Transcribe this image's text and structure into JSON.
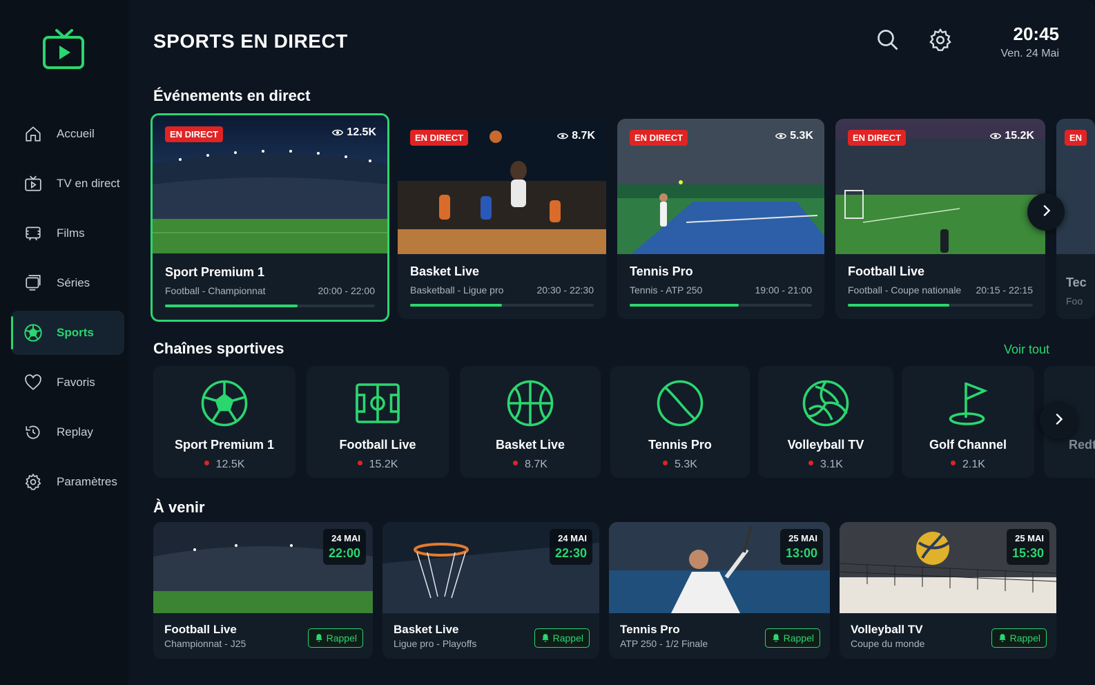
{
  "header": {
    "title": "SPORTS EN DIRECT",
    "time": "20:45",
    "date": "Ven. 24 Mai"
  },
  "sidebar": {
    "items": [
      {
        "label": "Accueil",
        "icon": "home-icon"
      },
      {
        "label": "TV en direct",
        "icon": "tv-icon"
      },
      {
        "label": "Films",
        "icon": "film-icon"
      },
      {
        "label": "Séries",
        "icon": "series-icon"
      },
      {
        "label": "Sports",
        "icon": "soccer-ball-icon",
        "active": true
      },
      {
        "label": "Favoris",
        "icon": "heart-icon"
      },
      {
        "label": "Replay",
        "icon": "history-icon"
      },
      {
        "label": "Paramètres",
        "icon": "gear-icon"
      }
    ]
  },
  "live": {
    "title": "Événements en direct",
    "badge": "EN DIRECT",
    "cards": [
      {
        "name": "Sport Premium 1",
        "subtitle": "Football - Championnat",
        "time": "20:00 - 22:00",
        "viewers": "12.5K",
        "progress": 0.63
      },
      {
        "name": "Basket Live",
        "subtitle": "Basketball - Ligue pro",
        "time": "20:30 - 22:30",
        "viewers": "8.7K",
        "progress": 0.5
      },
      {
        "name": "Tennis Pro",
        "subtitle": "Tennis - ATP 250",
        "time": "19:00 - 21:00",
        "viewers": "5.3K",
        "progress": 0.6
      },
      {
        "name": "Football Live",
        "subtitle": "Football - Coupe nationale",
        "time": "20:15 - 22:15",
        "viewers": "15.2K",
        "progress": 0.55
      },
      {
        "name": "Tec",
        "subtitle": "Foo"
      }
    ],
    "partial_badge": "EN"
  },
  "channels": {
    "title": "Chaînes sportives",
    "see_all": "Voir tout",
    "items": [
      {
        "name": "Sport Premium 1",
        "viewers": "12.5K",
        "icon": "soccer-ball-icon"
      },
      {
        "name": "Football Live",
        "viewers": "15.2K",
        "icon": "football-pitch-icon"
      },
      {
        "name": "Basket Live",
        "viewers": "8.7K",
        "icon": "basketball-icon"
      },
      {
        "name": "Tennis Pro",
        "viewers": "5.3K",
        "icon": "tennis-ball-icon"
      },
      {
        "name": "Volleyball TV",
        "viewers": "3.1K",
        "icon": "volleyball-icon"
      },
      {
        "name": "Golf Channel",
        "viewers": "2.1K",
        "icon": "golf-flag-icon"
      },
      {
        "name": "Redt",
        "viewers": ""
      }
    ]
  },
  "upcoming": {
    "title": "À venir",
    "reminder_label": "Rappel",
    "items": [
      {
        "name": "Football Live",
        "subtitle": "Championnat - J25",
        "date": "24 MAI",
        "time": "22:00"
      },
      {
        "name": "Basket Live",
        "subtitle": "Ligue pro - Playoffs",
        "date": "24 MAI",
        "time": "22:30"
      },
      {
        "name": "Tennis Pro",
        "subtitle": "ATP 250 - 1/2 Finale",
        "date": "25 MAI",
        "time": "13:00"
      },
      {
        "name": "Volleyball TV",
        "subtitle": "Coupe du monde",
        "date": "25 MAI",
        "time": "15:30"
      }
    ]
  },
  "colors": {
    "accent": "#2bd66f",
    "live_red": "#e02424",
    "background": "#0d1520",
    "card": "#131d28"
  }
}
